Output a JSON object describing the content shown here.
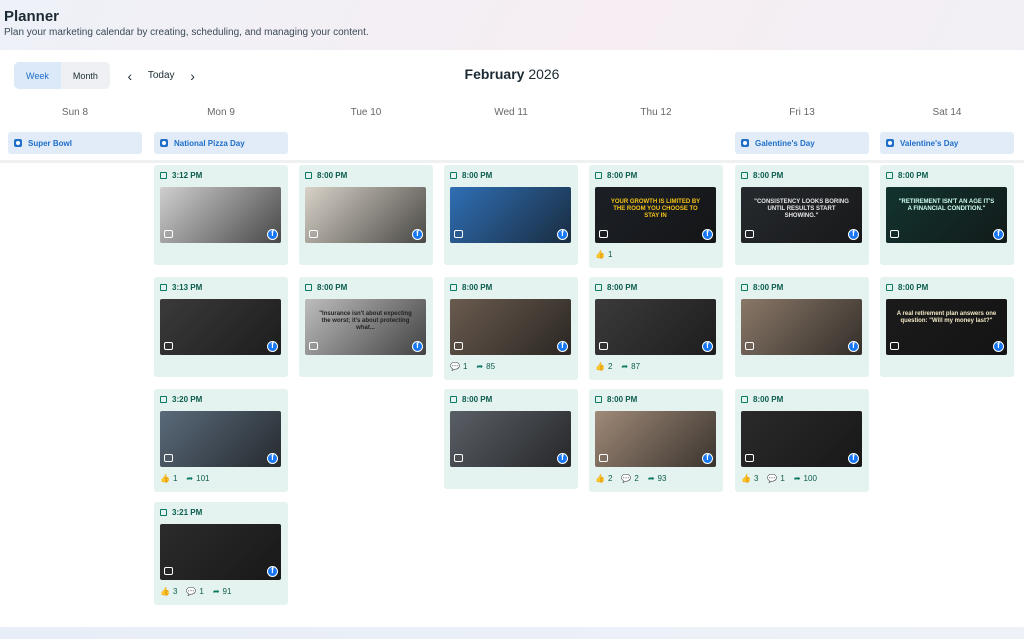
{
  "header": {
    "title": "Planner",
    "subtitle": "Plan your marketing calendar by creating, scheduling, and managing your content."
  },
  "toolbar": {
    "views": [
      {
        "label": "Week",
        "active": true
      },
      {
        "label": "Month",
        "active": false
      }
    ],
    "prev_icon": "chevron-left-icon",
    "today_label": "Today",
    "next_icon": "chevron-right-icon",
    "month_name": "February",
    "year": "2026"
  },
  "days": [
    {
      "label": "Sun 8",
      "event": "Super Bowl"
    },
    {
      "label": "Mon 9",
      "event": "National Pizza Day"
    },
    {
      "label": "Tue 10",
      "event": ""
    },
    {
      "label": "Wed 11",
      "event": ""
    },
    {
      "label": "Thu 12",
      "event": ""
    },
    {
      "label": "Fri 13",
      "event": "Galentine's Day"
    },
    {
      "label": "Sat 14",
      "event": "Valentine's Day"
    }
  ],
  "colors": {
    "accent": "#1f6ec7",
    "post_bg": "#e4f3ef",
    "post_text": "#0b5c4e",
    "facebook": "#1877f2"
  },
  "posts": [
    {
      "day": 1,
      "time": "3:12 PM",
      "caption": "",
      "format": "carousel",
      "bg": "#cfcfcf",
      "fg": "#333",
      "stats": {}
    },
    {
      "day": 1,
      "time": "3:13 PM",
      "caption": "",
      "format": "carousel",
      "bg": "#3a3a3a",
      "fg": "#ddd",
      "stats": {}
    },
    {
      "day": 1,
      "time": "3:20 PM",
      "caption": "",
      "format": "reel",
      "bg": "#5a6a7a",
      "fg": "#fff",
      "stats": {
        "likes": "1",
        "shares": "101"
      }
    },
    {
      "day": 1,
      "time": "3:21 PM",
      "caption": "",
      "format": "reel",
      "bg": "#2b2b2b",
      "fg": "#eee",
      "stats": {
        "likes": "3",
        "comments": "1",
        "shares": "91"
      }
    },
    {
      "day": 2,
      "time": "8:00 PM",
      "caption": "",
      "format": "carousel",
      "bg": "#d8d2c8",
      "fg": "#333",
      "stats": {}
    },
    {
      "day": 2,
      "time": "8:00 PM",
      "caption": "\"Insurance isn't about expecting the worst; it's about protecting what...",
      "format": "carousel",
      "bg": "#bdbdbd",
      "fg": "#222",
      "stats": {}
    },
    {
      "day": 3,
      "time": "8:00 PM",
      "caption": "",
      "format": "carousel",
      "bg": "#2f6fb5",
      "fg": "#fff",
      "stats": {}
    },
    {
      "day": 3,
      "time": "8:00 PM",
      "caption": "",
      "format": "reel",
      "bg": "#6a5b4f",
      "fg": "#fff",
      "stats": {
        "comments": "1",
        "shares": "85"
      }
    },
    {
      "day": 3,
      "time": "8:00 PM",
      "caption": "",
      "format": "carousel",
      "bg": "#5a5f66",
      "fg": "#fff",
      "stats": {}
    },
    {
      "day": 4,
      "time": "8:00 PM",
      "caption": "YOUR GROWTH IS LIMITED BY THE ROOM YOU CHOOSE TO STAY IN",
      "format": "carousel",
      "bg": "#1c2026",
      "fg": "#f5c518",
      "stats": {
        "likes": "1"
      }
    },
    {
      "day": 4,
      "time": "8:00 PM",
      "caption": "",
      "format": "carousel",
      "bg": "#3b3b3b",
      "fg": "#ddd",
      "stats": {
        "likes": "2",
        "shares": "87"
      }
    },
    {
      "day": 4,
      "time": "8:00 PM",
      "caption": "",
      "format": "reel",
      "bg": "#a08a78",
      "fg": "#fff",
      "stats": {
        "likes": "2",
        "comments": "2",
        "shares": "93"
      }
    },
    {
      "day": 5,
      "time": "8:00 PM",
      "caption": "\"CONSISTENCY LOOKS BORING UNTIL RESULTS START SHOWING.\"",
      "format": "carousel",
      "bg": "#262a2e",
      "fg": "#e6e6e6",
      "stats": {}
    },
    {
      "day": 5,
      "time": "8:00 PM",
      "caption": "",
      "format": "carousel",
      "bg": "#8a7868",
      "fg": "#fff",
      "stats": {}
    },
    {
      "day": 5,
      "time": "8:00 PM",
      "caption": "",
      "format": "reel",
      "bg": "#2a2a2a",
      "fg": "#fff",
      "stats": {
        "likes": "3",
        "comments": "1",
        "shares": "100"
      }
    },
    {
      "day": 6,
      "time": "8:00 PM",
      "caption": "\"RETIREMENT ISN'T AN AGE IT'S A FINANCIAL CONDITION.\"",
      "format": "carousel",
      "bg": "#12332f",
      "fg": "#cfe",
      "stats": {}
    },
    {
      "day": 6,
      "time": "8:00 PM",
      "caption": "A real retirement plan answers one question: \"Will my money last?\"",
      "format": "carousel",
      "bg": "#1b1b1b",
      "fg": "#f3e9c6",
      "stats": {}
    }
  ]
}
